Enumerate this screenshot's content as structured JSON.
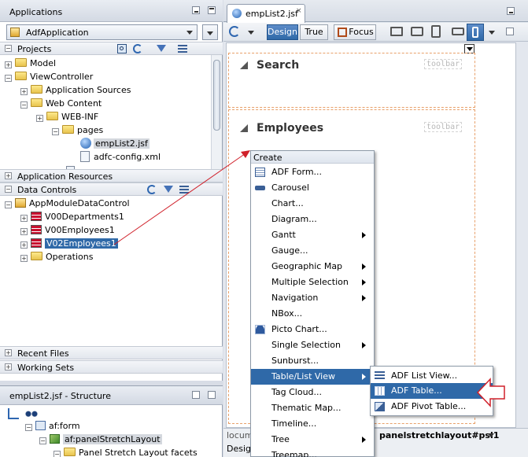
{
  "applications": {
    "title": "Applications",
    "app_name": "AdfApplication"
  },
  "projects": {
    "title": "Projects",
    "tree": [
      {
        "label": "Model",
        "level": 0,
        "expanded": false
      },
      {
        "label": "ViewController",
        "level": 0,
        "expanded": true
      },
      {
        "label": "Application Sources",
        "level": 1,
        "expanded": false
      },
      {
        "label": "Web Content",
        "level": 1,
        "expanded": true
      },
      {
        "label": "WEB-INF",
        "level": 2,
        "expanded": true
      },
      {
        "label": "pages",
        "level": 3,
        "expanded": true
      },
      {
        "label": "empList2.jsf",
        "level": 4,
        "selected": true
      },
      {
        "label": "adfc-config.xml",
        "level": 4
      }
    ]
  },
  "sections": {
    "application_resources": "Application Resources",
    "data_controls": "Data Controls",
    "recent_files": "Recent Files",
    "working_sets": "Working Sets"
  },
  "data_controls": {
    "tree": [
      {
        "label": "AppModuleDataControl"
      },
      {
        "label": "V00Departments1"
      },
      {
        "label": "V00Employees1"
      },
      {
        "label": "V02Employees1",
        "selected": true
      },
      {
        "label": "Operations"
      }
    ]
  },
  "structure": {
    "title": "empList2.jsf - Structure",
    "tree": [
      {
        "label": "af:form"
      },
      {
        "label": "af:panelStretchLayout"
      },
      {
        "label": "Panel Stretch Layout facets"
      }
    ]
  },
  "editor": {
    "tab": "empList2.jsf",
    "toolbar": {
      "design": "Design",
      "true": "True",
      "focus": "Focus"
    },
    "panels": [
      {
        "title": "Search",
        "toolbar": "toolbar"
      },
      {
        "title": "Employees",
        "toolbar": "toolbar"
      }
    ],
    "bottom_left": "locum",
    "bottom_tab": "Design",
    "breadcrumb": "panelstretchlayout#psl1"
  },
  "create_menu": {
    "header": "Create",
    "items": [
      {
        "label": "ADF Form...",
        "icon": "form-icon"
      },
      {
        "label": "Carousel",
        "icon": "carousel-icon"
      },
      {
        "label": "Chart..."
      },
      {
        "label": "Diagram..."
      },
      {
        "label": "Gantt",
        "submenu": true
      },
      {
        "label": "Gauge..."
      },
      {
        "label": "Geographic Map",
        "submenu": true
      },
      {
        "label": "Multiple Selection",
        "submenu": true
      },
      {
        "label": "Navigation",
        "submenu": true
      },
      {
        "label": "NBox..."
      },
      {
        "label": "Picto Chart...",
        "icon": "person-icon"
      },
      {
        "label": "Single Selection",
        "submenu": true
      },
      {
        "label": "Sunburst..."
      },
      {
        "label": "Table/List View",
        "submenu": true,
        "selected": true
      },
      {
        "label": "Tag Cloud..."
      },
      {
        "label": "Thematic Map..."
      },
      {
        "label": "Timeline..."
      },
      {
        "label": "Tree",
        "submenu": true
      },
      {
        "label": "Treemap..."
      }
    ]
  },
  "sub_menu": {
    "items": [
      {
        "label": "ADF List View...",
        "icon": "list-icon"
      },
      {
        "label": "ADF Table...",
        "icon": "table-icon",
        "selected": true
      },
      {
        "label": "ADF Pivot Table...",
        "icon": "pivot-icon"
      }
    ]
  },
  "colors": {
    "selection": "#2f69a8",
    "arrow_line": "#d0202a",
    "accent_border": "#e8a06a"
  }
}
